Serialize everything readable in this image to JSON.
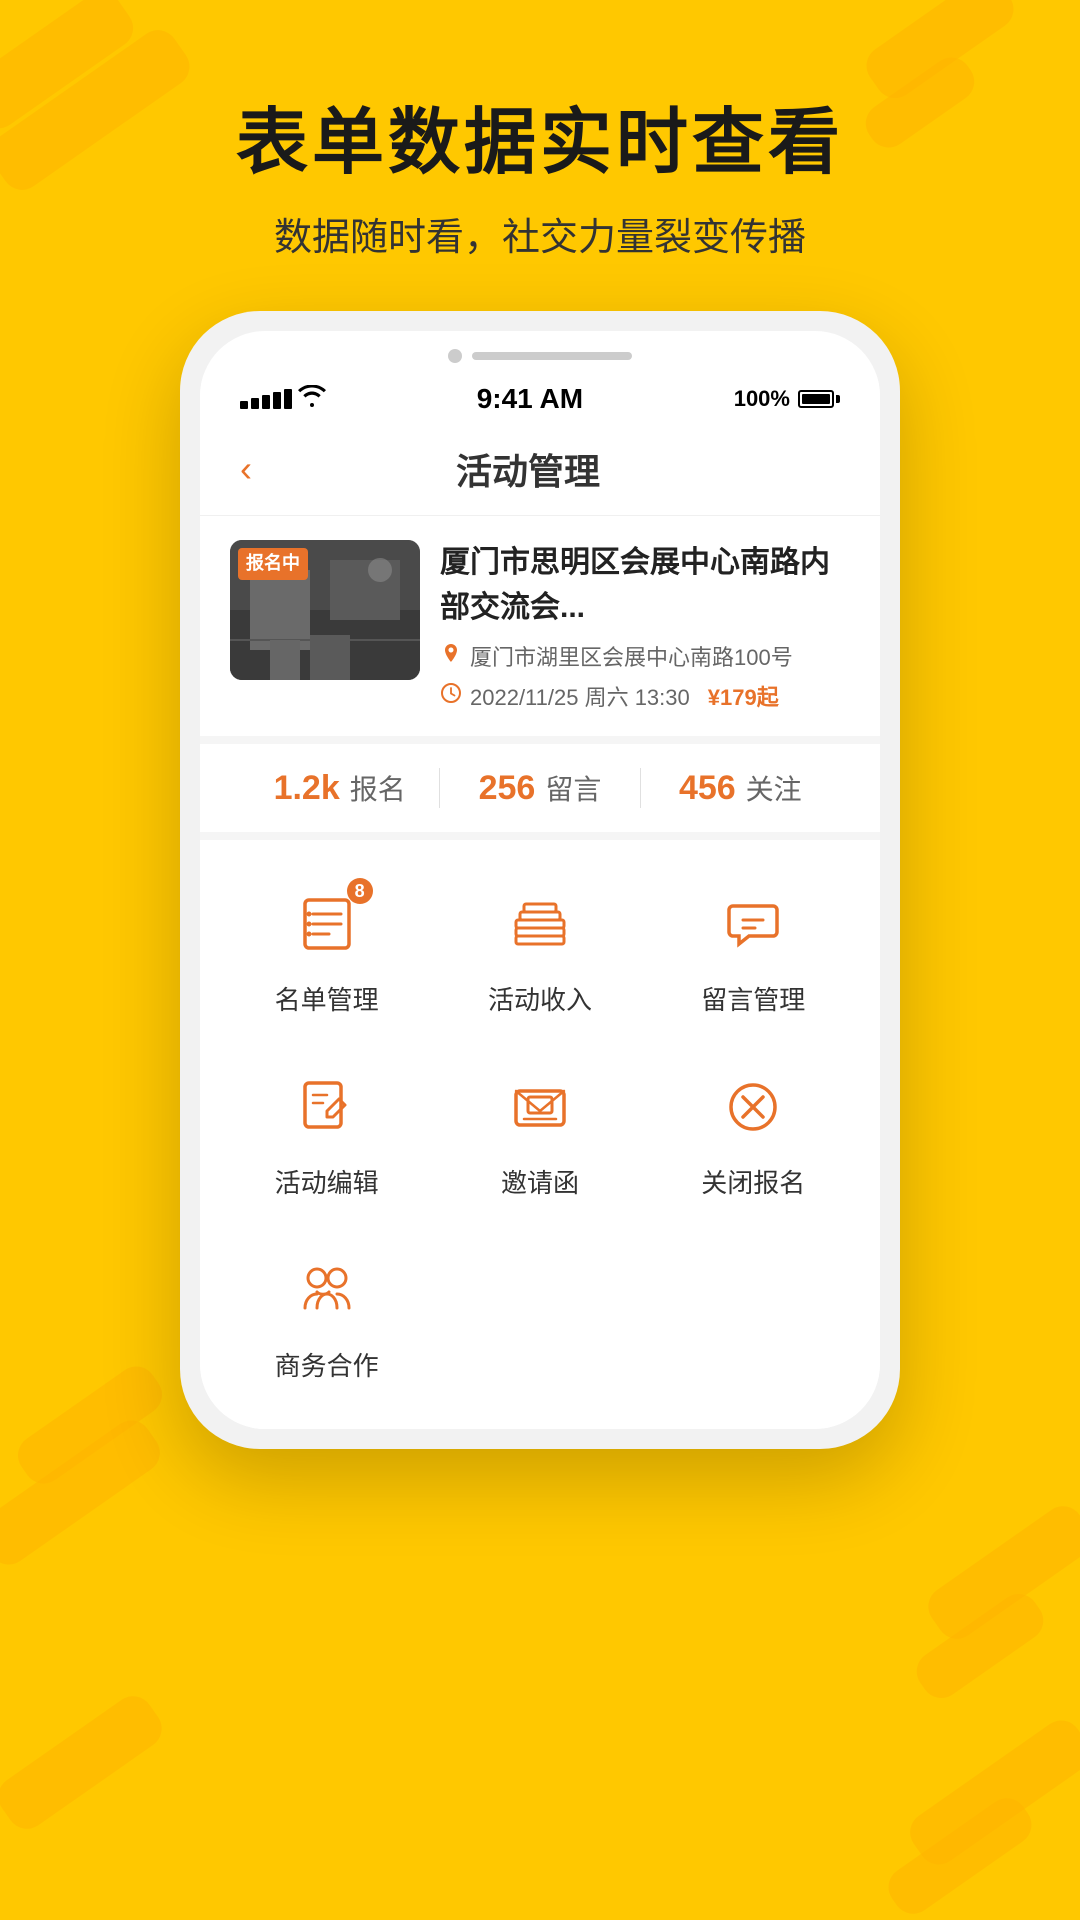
{
  "background": {
    "color": "#FFC800"
  },
  "hero": {
    "title": "表单数据实时查看",
    "subtitle": "数据随时看，社交力量裂变传播"
  },
  "status_bar": {
    "time": "9:41 AM",
    "battery": "100%"
  },
  "nav": {
    "back_icon": "‹",
    "title": "活动管理"
  },
  "event": {
    "badge": "报名中",
    "title": "厦门市思明区会展中心南路内部交流会...",
    "location": "厦门市湖里区会展中心南路100号",
    "date": "2022/11/25 周六 13:30",
    "price": "¥179起"
  },
  "stats": [
    {
      "number": "1.2k",
      "label": "报名"
    },
    {
      "number": "256",
      "label": "留言"
    },
    {
      "number": "456",
      "label": "关注"
    }
  ],
  "menu_items": [
    {
      "id": "list-manage",
      "label": "名单管理",
      "icon": "list",
      "badge": "8"
    },
    {
      "id": "activity-income",
      "label": "活动收入",
      "icon": "money",
      "badge": ""
    },
    {
      "id": "comment-manage",
      "label": "留言管理",
      "icon": "comment",
      "badge": ""
    },
    {
      "id": "activity-edit",
      "label": "活动编辑",
      "icon": "edit",
      "badge": ""
    },
    {
      "id": "invitation",
      "label": "邀请函",
      "icon": "invitation",
      "badge": ""
    },
    {
      "id": "close-register",
      "label": "关闭报名",
      "icon": "close-circle",
      "badge": ""
    },
    {
      "id": "business-coop",
      "label": "商务合作",
      "icon": "business",
      "badge": ""
    }
  ]
}
